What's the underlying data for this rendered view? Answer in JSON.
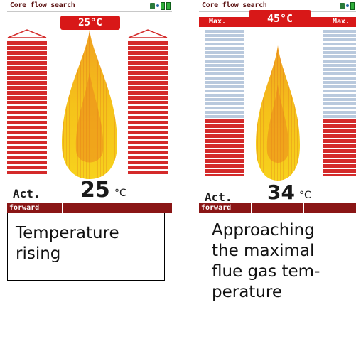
{
  "colors": {
    "bar_red": "#d42a2a",
    "banner_red": "#d81818",
    "softkey_bar": "#8a1616",
    "bar_blue": "#b9c9dd"
  },
  "screens": [
    {
      "title": "Core flow search",
      "temp_banner": "25°C",
      "act_label": "Act.",
      "act_value": "25",
      "act_unit": "°C",
      "softkey_left": "forward",
      "bar_fill_fraction": 1.0,
      "caption": [
        "Temperature",
        "rising"
      ]
    },
    {
      "title": "Core flow search",
      "max_left": "Max.",
      "temp_banner": "45°C",
      "max_right": "Max.",
      "act_label": "Act.",
      "act_value": "34",
      "act_unit": "°C",
      "softkey_left": "forward",
      "bar_fill_fraction": 0.3,
      "caption": [
        "Approaching",
        "the maximal",
        "flue gas tem-",
        "perature"
      ]
    }
  ],
  "icons": [
    "probe-icon",
    "signal-icon",
    "battery-icon"
  ]
}
